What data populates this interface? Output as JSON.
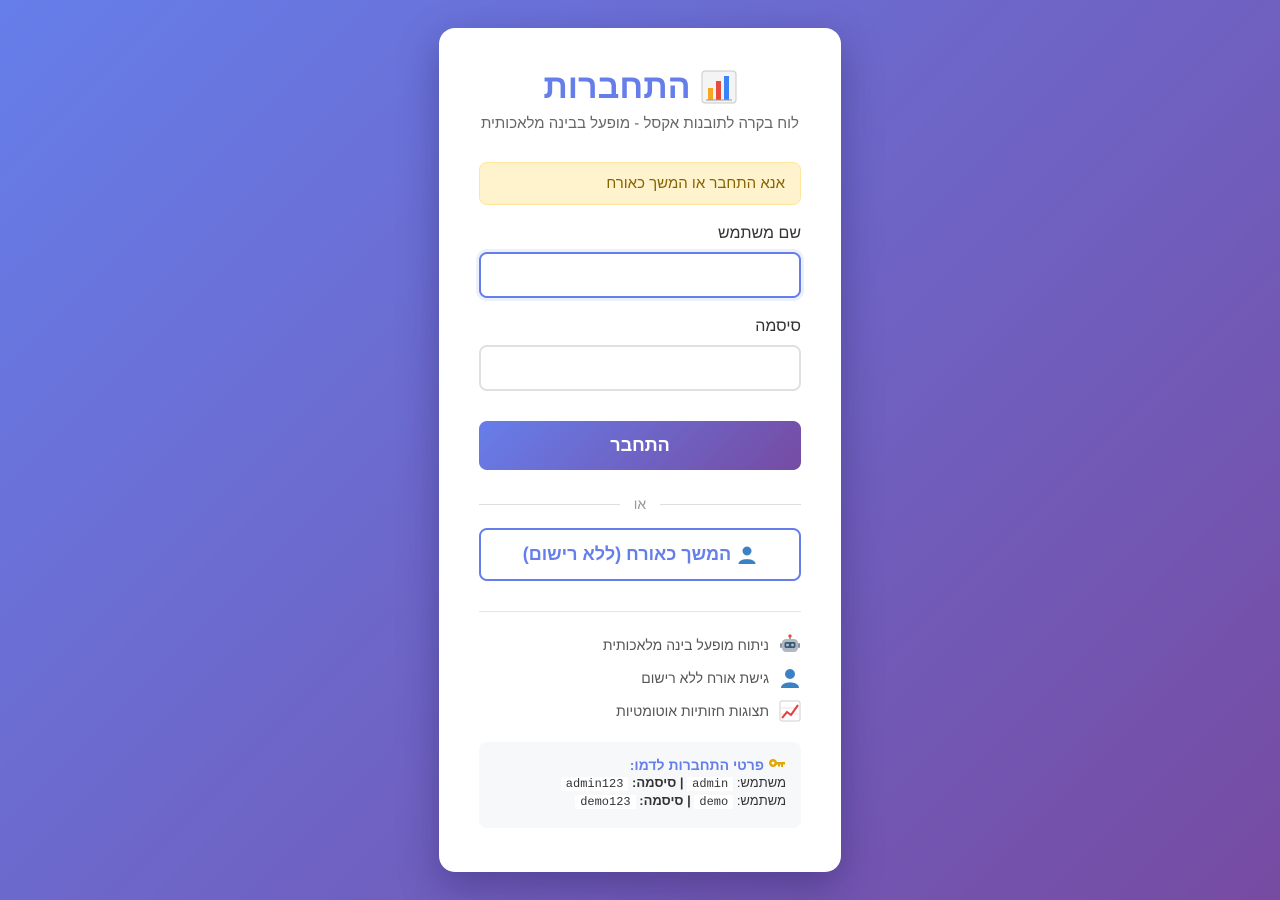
{
  "login": {
    "title": "התחברות",
    "subtitle": "לוח בקרה לתובנות אקסל - מופעל בבינה מלאכותית",
    "alert": "אנא התחבר או המשך כאורח",
    "username_label": "שם משתמש",
    "username_value": "",
    "password_label": "סיסמה",
    "password_value": "",
    "login_button": "התחבר",
    "divider_text": "או",
    "guest_button": "המשך כאורח (ללא רישום)"
  },
  "features": [
    {
      "icon": "robot-icon",
      "text": "ניתוח מופעל בינה מלאכותית"
    },
    {
      "icon": "person-icon",
      "text": "גישת אורח ללא רישום"
    },
    {
      "icon": "chart-increasing-icon",
      "text": "תצוגות חזותיות אוטומטיות"
    }
  ],
  "demo": {
    "title": "פרטי התחברות לדמו:",
    "user_label": "משתמש:",
    "password_label": "סיסמה:",
    "separator": "|",
    "accounts": [
      {
        "user": "admin",
        "password": "admin123"
      },
      {
        "user": "demo",
        "password": "demo123"
      }
    ]
  },
  "colors": {
    "accent": "#667eea",
    "gradient_end": "#764ba2",
    "alert_bg": "#fff3cd",
    "alert_text": "#856404"
  }
}
